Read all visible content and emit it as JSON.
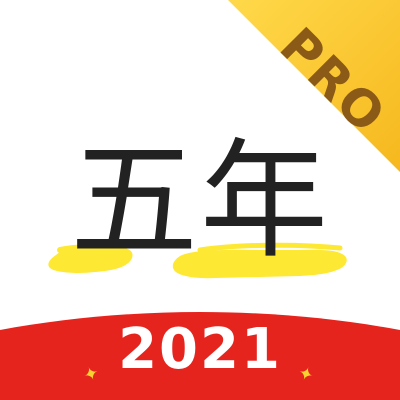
{
  "icon": {
    "title": "五年",
    "badge": "PRO",
    "year": "2021"
  },
  "colors": {
    "background": "#ffffff",
    "ribbon_gold": "#f6b81e",
    "ribbon_light": "#ffd94a",
    "badge_text": "#8a5a16",
    "highlight_yellow": "#fde833",
    "title_ink": "#222222",
    "banner_red": "#e6241e",
    "year_text": "#ffffff",
    "sparkle": "#f7d230"
  },
  "icons": {
    "sparkle_left": "sparkle-icon",
    "sparkle_right": "sparkle-icon"
  }
}
